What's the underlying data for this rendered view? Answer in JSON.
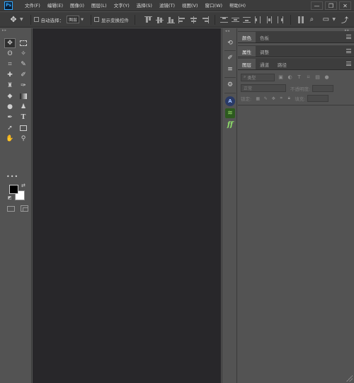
{
  "app": {
    "logo": "Ps"
  },
  "menu": [
    "文件(F)",
    "编辑(E)",
    "图像(I)",
    "图层(L)",
    "文字(Y)",
    "选择(S)",
    "滤镜(T)",
    "视图(V)",
    "窗口(W)",
    "帮助(H)"
  ],
  "window_controls": {
    "minimize": "—",
    "restore": "❐",
    "close": "✕"
  },
  "options": {
    "auto_select_label": "自动选择：",
    "auto_select_value": "图层",
    "show_transform_label": "显示变换控件"
  },
  "panels": {
    "group1_tabs": [
      "颜色",
      "色板"
    ],
    "group2_tabs": [
      "属性",
      "调整"
    ],
    "group3_tabs": [
      "图层",
      "通道",
      "路径"
    ]
  },
  "layers": {
    "filter_placeholder": "类型",
    "blend_mode": "正常",
    "opacity_label": "不透明度:",
    "lock_label": "锁定:",
    "fill_label": "填充:"
  },
  "colors": {
    "foreground": "#000000",
    "background": "#ffffff",
    "canvas": "#28272a",
    "chrome": "#3c3c3c",
    "panel": "#535353",
    "accent": "#31a8ff"
  }
}
